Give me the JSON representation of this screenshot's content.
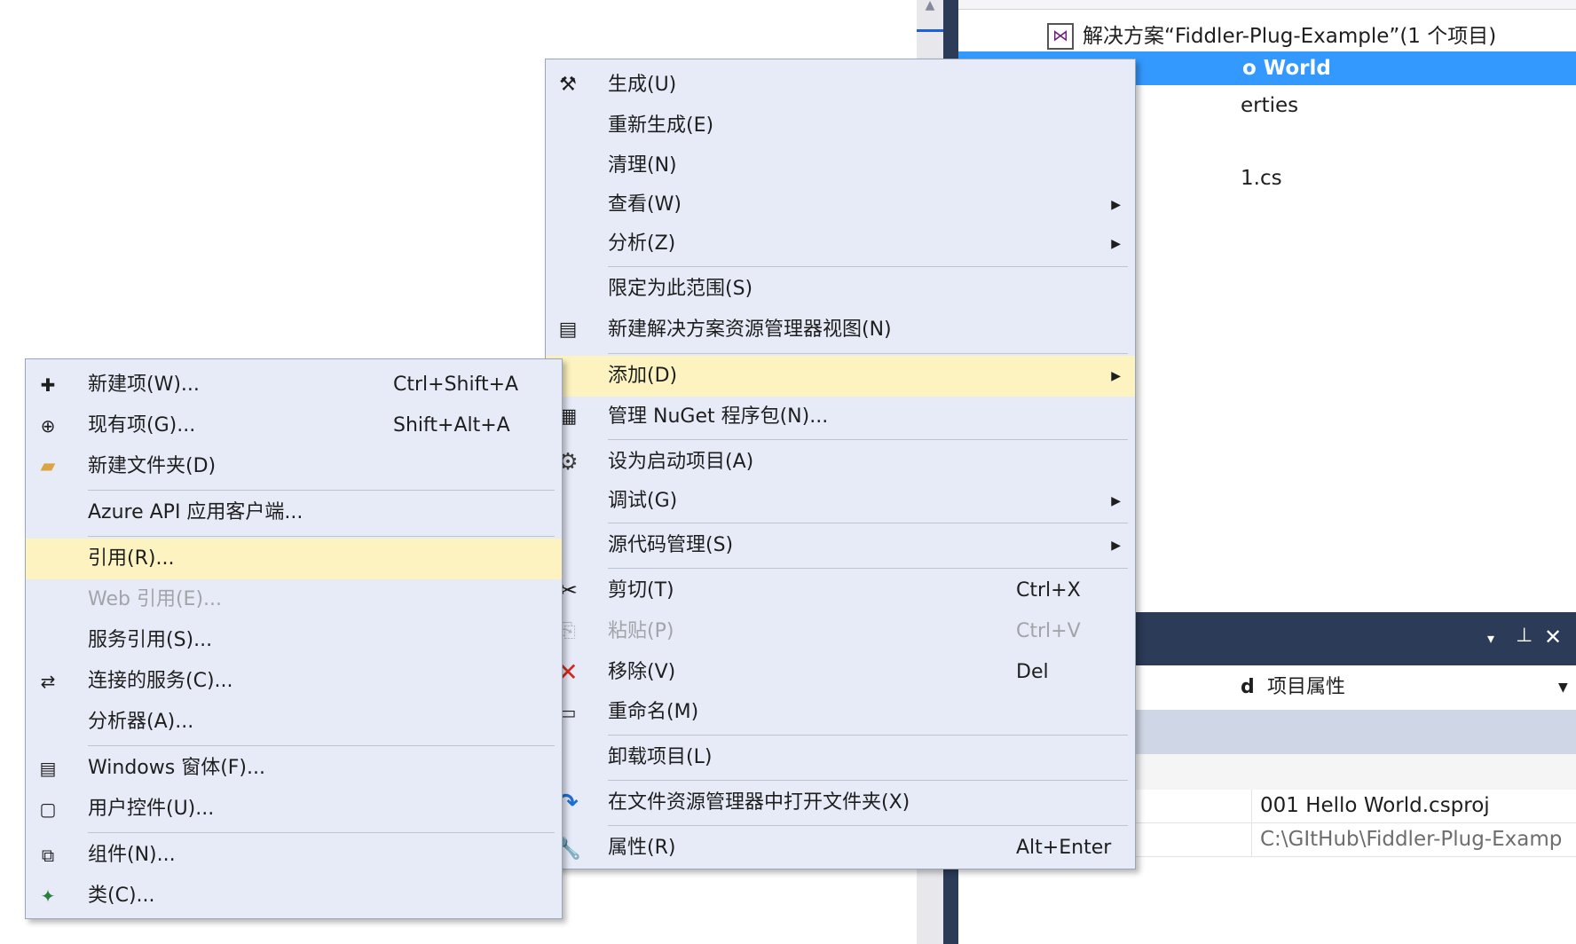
{
  "solution_explorer": {
    "solution_label": "解决方案“Fiddler-Plug-Example”(1 个项目)",
    "project_partial": "o World",
    "properties_partial": "erties",
    "file_partial": "1.cs"
  },
  "properties_panel": {
    "pin_glyph": "▾",
    "combo_label": "项目属性",
    "combo_prefix": "d",
    "project_file": "001 Hello World.csproj",
    "project_path": "C:\\GItHub\\Fiddler-Plug-Examp"
  },
  "main_menu": {
    "items": [
      {
        "label": "生成(U)"
      },
      {
        "label": "重新生成(E)"
      },
      {
        "label": "清理(N)"
      },
      {
        "label": "查看(W)"
      },
      {
        "label": "分析(Z)"
      },
      {
        "label": "限定为此范围(S)"
      },
      {
        "label": "新建解决方案资源管理器视图(N)"
      },
      {
        "label": "添加(D)"
      },
      {
        "label": "管理 NuGet 程序包(N)..."
      },
      {
        "label": "设为启动项目(A)"
      },
      {
        "label": "调试(G)"
      },
      {
        "label": "源代码管理(S)"
      },
      {
        "label": "剪切(T)",
        "shortcut": "Ctrl+X"
      },
      {
        "label": "粘贴(P)",
        "shortcut": "Ctrl+V"
      },
      {
        "label": "移除(V)",
        "shortcut": "Del"
      },
      {
        "label": "重命名(M)"
      },
      {
        "label": "卸载项目(L)"
      },
      {
        "label": "在文件资源管理器中打开文件夹(X)"
      },
      {
        "label": "属性(R)",
        "shortcut": "Alt+Enter"
      }
    ]
  },
  "add_submenu": {
    "items": [
      {
        "label": "新建项(W)...",
        "shortcut": "Ctrl+Shift+A"
      },
      {
        "label": "现有项(G)...",
        "shortcut": "Shift+Alt+A"
      },
      {
        "label": "新建文件夹(D)"
      },
      {
        "label": "Azure API 应用客户端..."
      },
      {
        "label": "引用(R)..."
      },
      {
        "label": "Web 引用(E)..."
      },
      {
        "label": "服务引用(S)..."
      },
      {
        "label": "连接的服务(C)..."
      },
      {
        "label": "分析器(A)..."
      },
      {
        "label": "Windows 窗体(F)..."
      },
      {
        "label": "用户控件(U)..."
      },
      {
        "label": "组件(N)..."
      },
      {
        "label": "类(C)..."
      }
    ]
  },
  "colors": {
    "menu_bg": "#e7ebf8",
    "highlight": "#fdf3c0",
    "selection": "#3399ff",
    "panel_header": "#2b3b58",
    "remove_icon": "#d42a1f",
    "open_folder_icon": "#1d6fd1"
  }
}
